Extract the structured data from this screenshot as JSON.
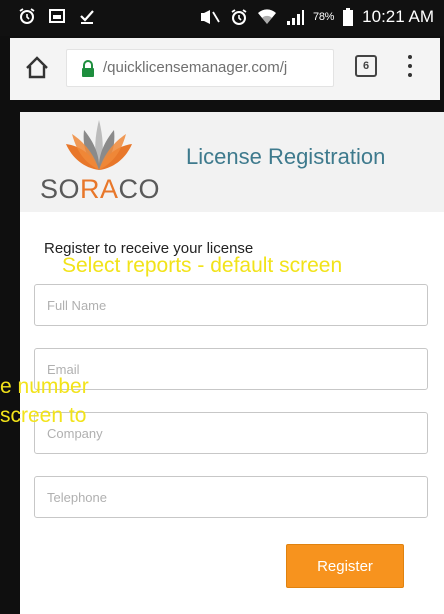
{
  "status_bar": {
    "battery_percent": "78%",
    "time": "10:21 AM",
    "icons": [
      "alarm-icon",
      "gallery-icon",
      "download-icon",
      "mute-icon",
      "alarm-icon",
      "wifi-icon",
      "signal-icon",
      "battery-icon"
    ]
  },
  "browser": {
    "url": "/quicklicensemanager.com/j",
    "tab_count": "6",
    "icons": [
      "home-icon",
      "lock-icon",
      "tabs-icon",
      "more-vert-icon"
    ]
  },
  "page": {
    "logo_text_parts": [
      "SO",
      "RA",
      "CO"
    ],
    "title": "License Registration",
    "intro": "Register to receive your license",
    "fields": [
      {
        "placeholder": "Full Name",
        "value": ""
      },
      {
        "placeholder": "Email",
        "value": ""
      },
      {
        "placeholder": "Company",
        "value": ""
      },
      {
        "placeholder": "Telephone",
        "value": ""
      }
    ],
    "register_label": "Register"
  },
  "overlays": [
    "Select reports - default screen",
    "e number",
    "screen to"
  ],
  "colors": {
    "accent": "#f7931e",
    "title": "#3e7a8d",
    "overlay": "#f2e31a",
    "logo_orange": "#e8772a"
  }
}
